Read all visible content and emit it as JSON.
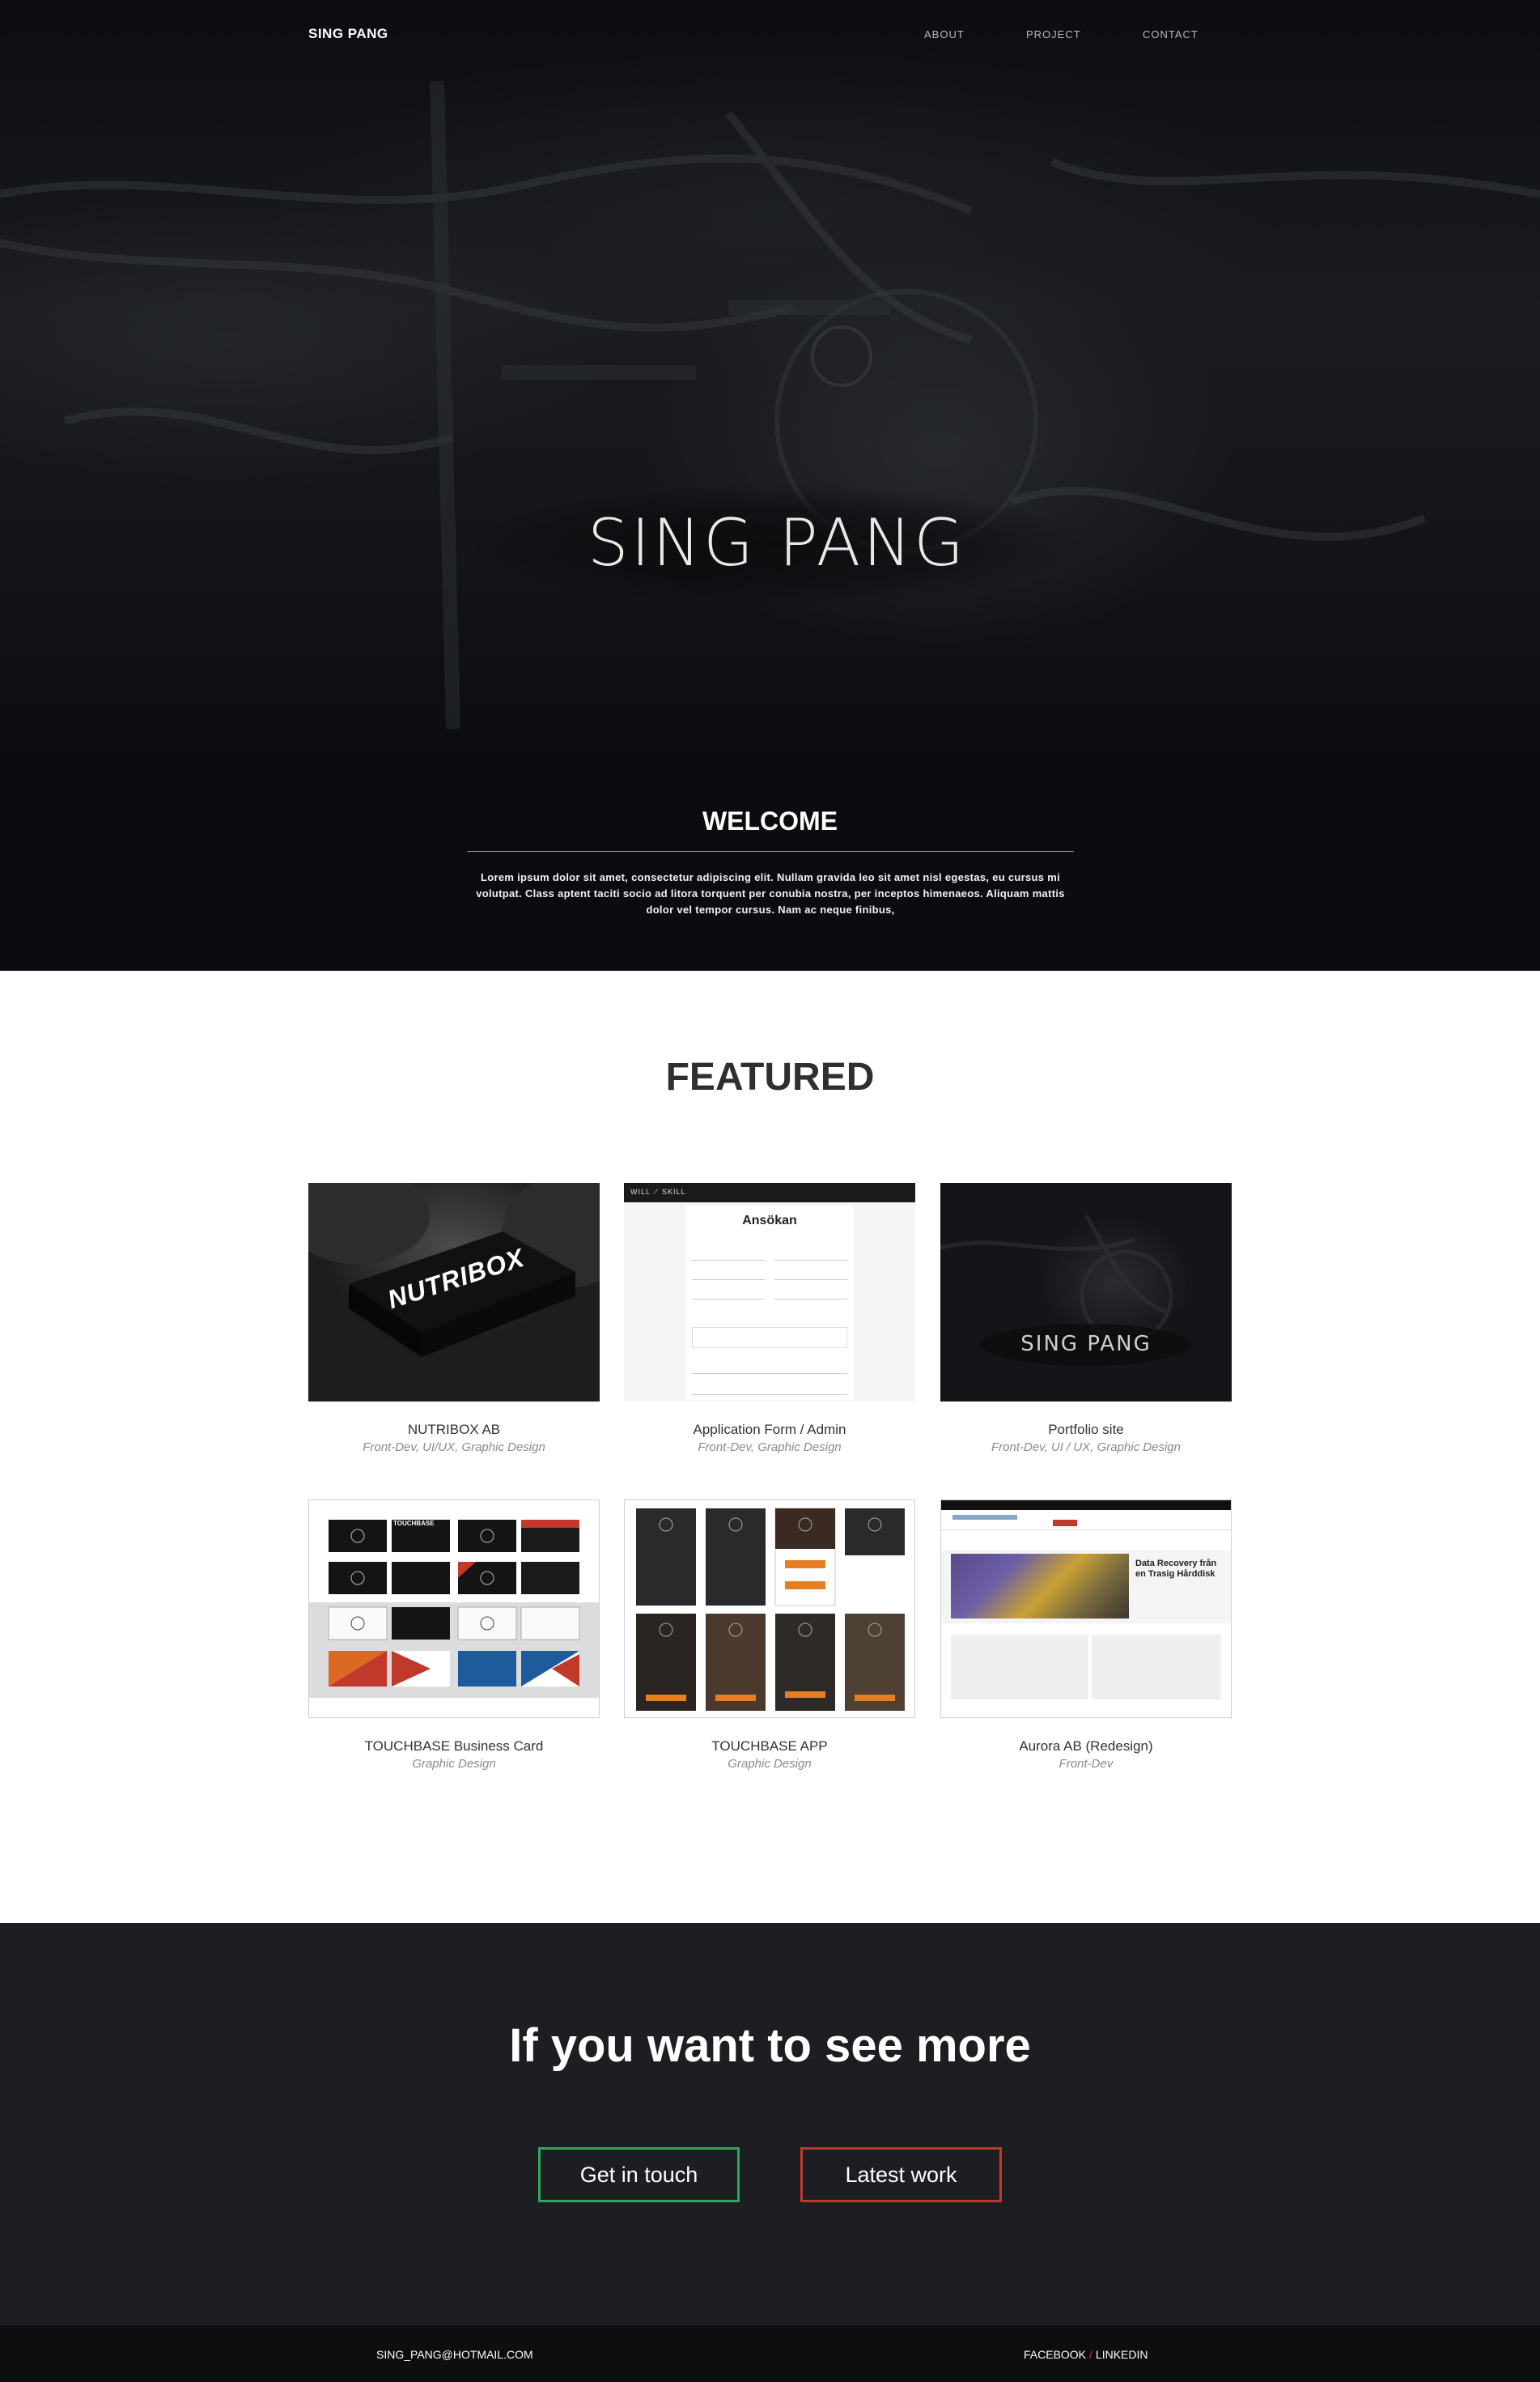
{
  "nav": {
    "brand": "SING PANG",
    "links": [
      "ABOUT",
      "PROJECT",
      "CONTACT"
    ]
  },
  "hero": {
    "title": "SING PANG"
  },
  "welcome": {
    "title": "WELCOME",
    "text": "Lorem ipsum dolor sit amet, consectetur adipiscing elit. Nullam gravida leo sit amet nisl egestas, eu cursus mi volutpat. Class aptent taciti socio ad litora torquent per conubia nostra, per inceptos himenaeos. Aliquam mattis dolor vel tempor cursus. Nam ac neque finibus,"
  },
  "featured": {
    "title": "FEATURED",
    "items": [
      {
        "title": "NUTRIBOX AB",
        "tags": "Front-Dev, UI/UX, Graphic Design",
        "thumb_text": "NUTRIBOX"
      },
      {
        "title": "Application Form / Admin",
        "tags": "Front-Dev, Graphic Design",
        "thumb_header": "WILL ⟋ SKILL",
        "thumb_heading": "Ansökan"
      },
      {
        "title": "Portfolio site",
        "tags": "Front-Dev, UI / UX, Graphic Design",
        "thumb_text": "SING PANG"
      },
      {
        "title": "TOUCHBASE Business Card",
        "tags": "Graphic Design",
        "thumb_text": "TOUCHBASE"
      },
      {
        "title": "TOUCHBASE APP",
        "tags": "Graphic Design"
      },
      {
        "title": "Aurora AB (Redesign)",
        "tags": "Front-Dev",
        "thumb_heading": "Data Recovery från en Trasig Hårddisk"
      }
    ]
  },
  "cta": {
    "title": "If you want to see more",
    "primary_label": "Get in touch",
    "secondary_label": "Latest work"
  },
  "footer": {
    "email": "SING_PANG@HOTMAIL.COM",
    "facebook": "FACEBOOK",
    "separator": "/",
    "linkedin": "LINKEDIN"
  },
  "colors": {
    "hero_bg": "#131418",
    "welcome_bg": "#0b0c10",
    "cta_bg": "#1d1e22",
    "footer_bg": "#0d0e10",
    "accent_green": "#2fa65b",
    "accent_red": "#c0392b",
    "accent_orange": "#e67e22"
  }
}
